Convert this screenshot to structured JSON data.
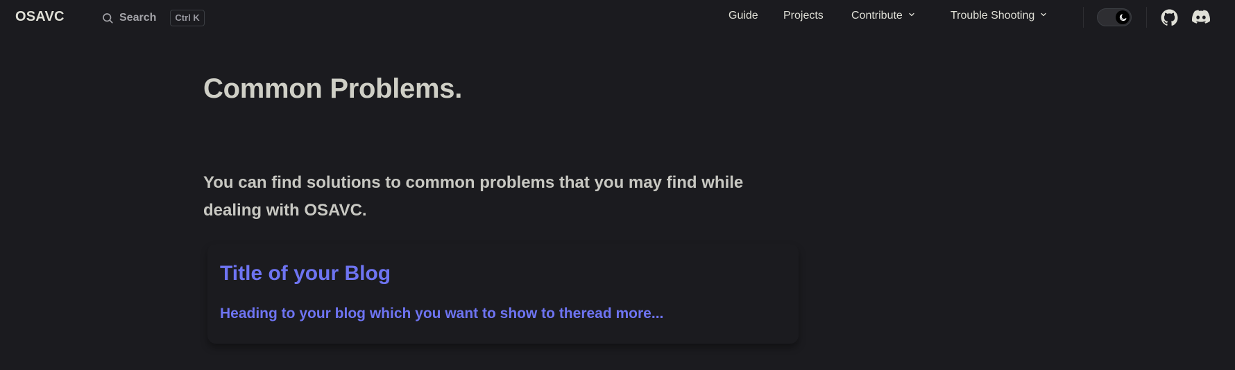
{
  "app": {
    "logo": "OSAVC"
  },
  "search": {
    "label": "Search",
    "shortcut": "Ctrl K"
  },
  "nav": {
    "items": [
      {
        "label": "Guide"
      },
      {
        "label": "Projects"
      },
      {
        "label": "Contribute"
      },
      {
        "label": "Trouble Shooting"
      }
    ]
  },
  "icons": {
    "search": "search-icon",
    "theme": "moon-icon",
    "github": "github-icon",
    "discord": "discord-icon"
  },
  "colors": {
    "background": "#1b1b1f",
    "text": "#dfdfd6",
    "accent": "#6e74f2"
  },
  "main": {
    "title": "Common Problems.",
    "intro": "You can find solutions to common problems that you may find while dealing with OSAVC.",
    "card": {
      "title": "Title of your Blog",
      "subtitle": "Heading to your blog which you want to show to theread more..."
    }
  }
}
